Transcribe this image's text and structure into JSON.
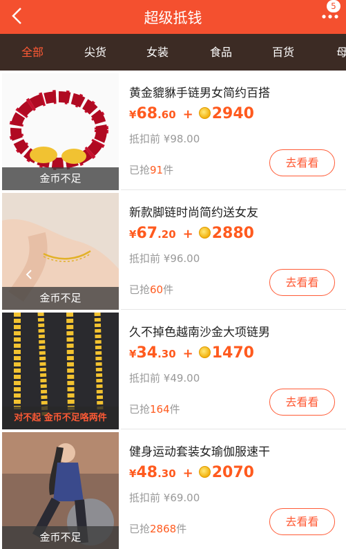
{
  "header": {
    "title": "超级抵钱",
    "badge": "5",
    "colors": {
      "bar": "#f4502f",
      "tabs_bg": "#3c2b24",
      "accent": "#ff5a35"
    }
  },
  "tabs": [
    {
      "label": "全部",
      "active": true
    },
    {
      "label": "尖货"
    },
    {
      "label": "女装"
    },
    {
      "label": "食品"
    },
    {
      "label": "百货"
    },
    {
      "label": "母"
    }
  ],
  "labels": {
    "orig_prefix": "抵扣前 ",
    "sold_prefix": "已抢",
    "sold_suffix": "件",
    "button": "去看看",
    "plus": "+",
    "yen": "¥"
  },
  "products": [
    {
      "name": "黄金貔貅手链男女简约百搭",
      "price_int": "68",
      "price_dec": ".60",
      "coins": "2940",
      "orig": "¥98.00",
      "sold": "91",
      "overlay": "金币不足",
      "image_icon": "bracelet-image"
    },
    {
      "name": "新款脚链时尚简约送女友",
      "price_int": "67",
      "price_dec": ".20",
      "coins": "2880",
      "orig": "¥96.00",
      "sold": "60",
      "overlay": "金币不足",
      "image_icon": "anklet-image"
    },
    {
      "name": "久不掉色越南沙金大项链男",
      "price_int": "34",
      "price_dec": ".30",
      "coins": "1470",
      "orig": "¥49.00",
      "sold": "164",
      "overlay": "对不起  金币不足咯两件",
      "image_icon": "necklace-image"
    },
    {
      "name": "健身运动套装女瑜伽服速干",
      "price_int": "48",
      "price_dec": ".30",
      "coins": "2070",
      "orig": "¥69.00",
      "sold": "2868",
      "overlay": "金币不足",
      "image_icon": "yoga-outfit-image"
    }
  ]
}
